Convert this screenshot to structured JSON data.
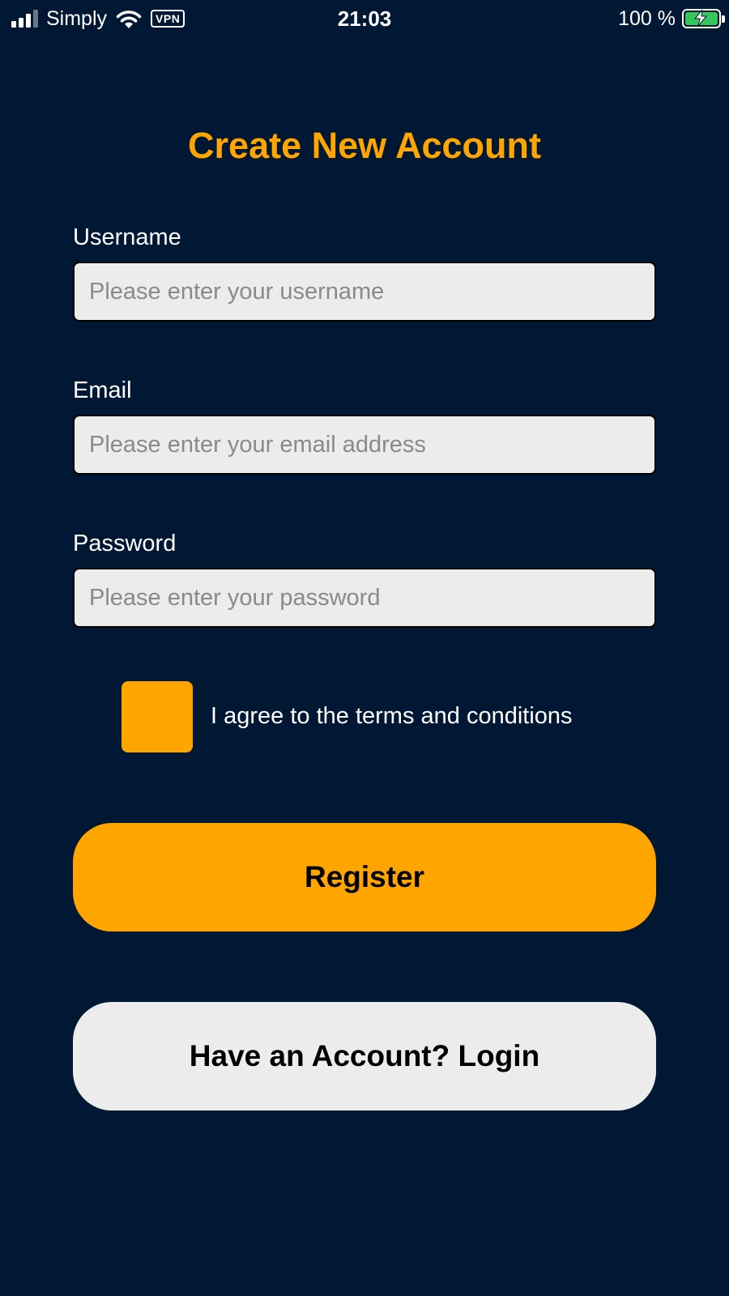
{
  "status_bar": {
    "carrier": "Simply",
    "vpn": "VPN",
    "time": "21:03",
    "battery": "100 %",
    "battery_color": "#34c759",
    "icons": [
      "signal-icon",
      "wifi-icon",
      "vpn-icon",
      "battery-charging-icon"
    ]
  },
  "page": {
    "title": "Create New Account",
    "accent_color": "#ffa500",
    "background_color": "#001833"
  },
  "form": {
    "username": {
      "label": "Username",
      "placeholder": "Please enter your username",
      "value": ""
    },
    "email": {
      "label": "Email",
      "placeholder": "Please enter your email address",
      "value": ""
    },
    "password": {
      "label": "Password",
      "placeholder": "Please enter your password",
      "value": ""
    },
    "terms": {
      "label": "I agree to the terms and conditions",
      "checked": false
    }
  },
  "actions": {
    "register_label": "Register",
    "login_label": "Have an Account? Login"
  }
}
